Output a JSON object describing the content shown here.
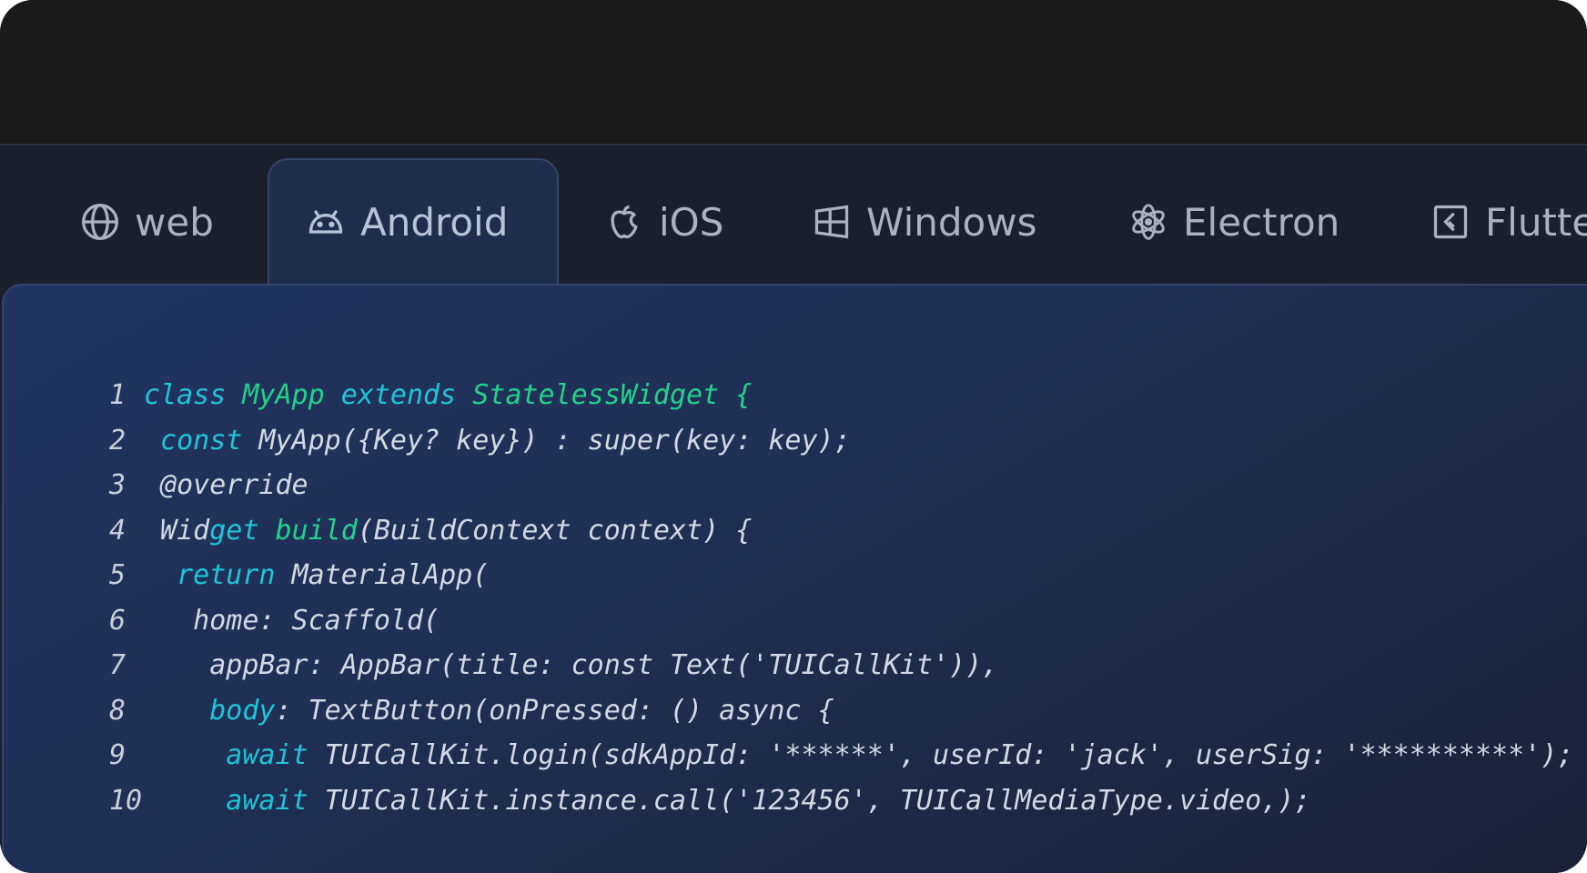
{
  "tabs": [
    {
      "label": "web",
      "icon": "globe-icon",
      "active": false
    },
    {
      "label": "Android",
      "icon": "android-icon",
      "active": true
    },
    {
      "label": "iOS",
      "icon": "apple-icon",
      "active": false
    },
    {
      "label": "Windows",
      "icon": "windows-icon",
      "active": false
    },
    {
      "label": "Electron",
      "icon": "electron-icon",
      "active": false
    },
    {
      "label": "Flutte",
      "icon": "flutter-icon",
      "active": false
    }
  ],
  "code": {
    "lines": [
      {
        "n": "1",
        "segs": [
          {
            "t": "class ",
            "c": "kw-cyan"
          },
          {
            "t": "MyApp ",
            "c": "kw-green"
          },
          {
            "t": "extends ",
            "c": "kw-cyan"
          },
          {
            "t": "StatelessWidget {",
            "c": "kw-green"
          }
        ]
      },
      {
        "n": "2",
        "segs": [
          {
            "t": " const ",
            "c": "kw-cyan"
          },
          {
            "t": "MyApp({Key? key}) : super(key: key);",
            "c": "plain"
          }
        ]
      },
      {
        "n": "3",
        "segs": [
          {
            "t": " @override",
            "c": "plain"
          }
        ]
      },
      {
        "n": "4",
        "segs": [
          {
            "t": " Wid",
            "c": "plain"
          },
          {
            "t": "get ",
            "c": "kw-cyan"
          },
          {
            "t": "build",
            "c": "kw-green"
          },
          {
            "t": "(BuildContext context) {",
            "c": "plain"
          }
        ]
      },
      {
        "n": "5",
        "segs": [
          {
            "t": "  return ",
            "c": "kw-cyan"
          },
          {
            "t": "MaterialApp(",
            "c": "plain"
          }
        ]
      },
      {
        "n": "6",
        "segs": [
          {
            "t": "   home: Scaffold(",
            "c": "plain"
          }
        ]
      },
      {
        "n": "7",
        "segs": [
          {
            "t": "    appBar: AppBar(title: const Text('TUICallKit')),",
            "c": "plain"
          }
        ]
      },
      {
        "n": "8",
        "segs": [
          {
            "t": "    body",
            "c": "kw-cyan"
          },
          {
            "t": ": TextButton(onPressed: () async {",
            "c": "plain"
          }
        ]
      },
      {
        "n": "9",
        "segs": [
          {
            "t": "     await ",
            "c": "kw-cyan"
          },
          {
            "t": "TUICallKit.login(sdkAppId: '******', userId: 'jack', userSig: '**********');",
            "c": "plain"
          }
        ]
      },
      {
        "n": "10",
        "segs": [
          {
            "t": "     await ",
            "c": "kw-cyan"
          },
          {
            "t": "TUICallKit.instance.call('123456', TUICallMediaType.video,);",
            "c": "plain"
          }
        ]
      }
    ]
  },
  "colors": {
    "keyword_green": "#21d28a",
    "keyword_cyan": "#1ec4d8",
    "text": "#d3d8e2",
    "tab_text": "#aab1bf",
    "active_tab_bg": "#1f2d4d"
  }
}
